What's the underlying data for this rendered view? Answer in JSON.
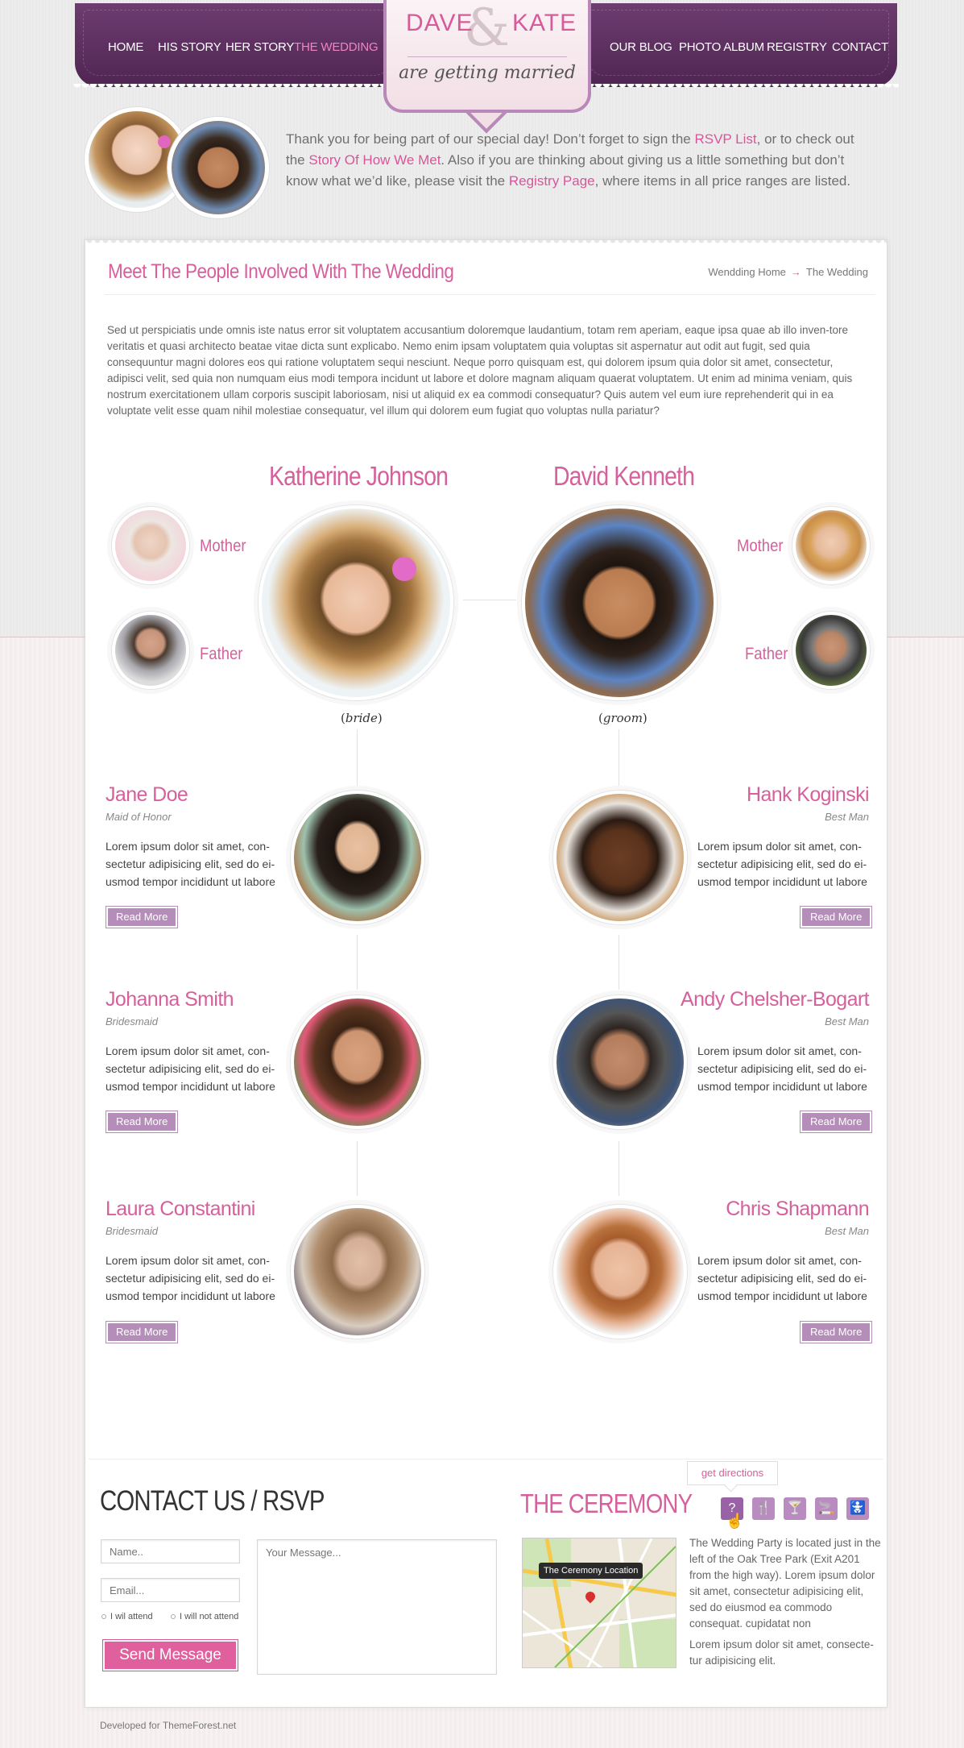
{
  "nav": {
    "left": [
      "HOME",
      "HIS STORY",
      "HER STORY",
      "THE WEDDING"
    ],
    "right": [
      "OUR BLOG",
      "PHOTO ALBUM",
      "REGISTRY",
      "CONTACT"
    ],
    "active": "THE WEDDING"
  },
  "logo": {
    "name1": "DAVE",
    "ampersand": "&",
    "name2": "KATE",
    "tagline": "are getting married"
  },
  "intro": {
    "t1": "Thank you for being part of our special day! Don’t forget to sign the ",
    "l1": "RSVP List",
    "t2": ", or to check out the ",
    "l2": "Story Of How We Met",
    "t3": ". Also if you are thinking about giving us a little something but don’t know what we’d like, please visit the ",
    "l3": "Registry Page",
    "t4": ", where items in all price ranges are listed."
  },
  "page": {
    "title": "Meet The People Involved With The Wedding",
    "breadcrumb": [
      "Wendding Home",
      "The Wedding"
    ],
    "breadcrumb_sep": "→",
    "lorem": "Sed ut perspiciatis unde omnis iste natus error sit voluptatem accusantium doloremque laudantium, totam rem aperiam, eaque ipsa quae ab illo inven-tore veritatis et quasi architecto beatae vitae dicta sunt explicabo. Nemo enim ipsam voluptatem quia voluptas sit aspernatur aut odit aut fugit, sed quia consequuntur magni dolores eos qui ratione voluptatem sequi nesciunt. Neque porro quisquam est, qui dolorem ipsum quia dolor sit amet, consectetur, adipisci velit, sed quia non numquam eius modi tempora incidunt ut labore et dolore magnam aliquam quaerat voluptatem. Ut enim ad minima veniam, quis nostrum exercitationem ullam corporis suscipit laboriosam, nisi ut aliquid ex ea commodi consequatur? Quis autem vel eum iure reprehenderit qui in ea voluptate velit esse quam nihil molestiae consequatur, vel illum qui dolorem eum fugiat quo voluptas nulla pariatur?"
  },
  "bride": {
    "name": "Katherine Johnson",
    "label": "bride",
    "mother": "Mother",
    "father": "Father"
  },
  "groom": {
    "name": "David Kenneth",
    "label": "groom",
    "mother": "Mother",
    "father": "Father"
  },
  "party_left": [
    {
      "name": "Jane Doe",
      "role": "Maid of Honor",
      "desc": "Lorem ipsum dolor sit amet, con-sectetur adipisicing elit, sed do ei-usmod tempor incididunt ut labore",
      "button": "Read More"
    },
    {
      "name": "Johanna Smith",
      "role": "Bridesmaid",
      "desc": "Lorem ipsum dolor sit amet, con-sectetur adipisicing elit, sed do ei-usmod tempor incididunt ut labore",
      "button": "Read More"
    },
    {
      "name": "Laura Constantini",
      "role": "Bridesmaid",
      "desc": "Lorem ipsum dolor sit amet, con-sectetur adipisicing elit, sed do ei-usmod tempor incididunt ut labore",
      "button": "Read More"
    }
  ],
  "party_right": [
    {
      "name": "Hank Koginski",
      "role": "Best Man",
      "desc": "Lorem ipsum dolor sit amet, con-sectetur adipisicing elit, sed do ei-usmod tempor incididunt ut labore",
      "button": "Read More"
    },
    {
      "name": "Andy Chelsher-Bogart",
      "role": "Best Man",
      "desc": "Lorem ipsum dolor sit amet, con-sectetur adipisicing elit, sed do ei-usmod tempor incididunt ut labore",
      "button": "Read More"
    },
    {
      "name": "Chris Shapmann",
      "role": "Best Man",
      "desc": "Lorem ipsum dolor sit amet, con-sectetur adipisicing elit, sed do ei-usmod tempor incididunt ut labore",
      "button": "Read More"
    }
  ],
  "contact": {
    "title": "CONTACT US / RSVP",
    "name_placeholder": "Name..",
    "email_placeholder": "Email...",
    "message_placeholder": "Your Message...",
    "radio_attend": "I wil attend",
    "radio_not": "I will not attend",
    "send": "Send Message"
  },
  "ceremony": {
    "title": "THE CEREMONY",
    "tooltip": "get directions",
    "icons": [
      "question-icon",
      "fork-knife-icon",
      "cocktail-icon",
      "cigarette-icon",
      "baby-icon"
    ],
    "map_label": "The Ceremony Location",
    "text1": "The Wedding Party is located just in the left of the Oak Tree Park (Exit A201 from the high way). Lorem ipsum dolor sit amet, consectetur adipisicing elit, sed do eiusmod ea commodo consequat. cupidatat non",
    "text2": "Lorem ipsum dolor sit amet, consecte-tur adipisicing elit."
  },
  "footer": "Developed for ThemeForest.net"
}
